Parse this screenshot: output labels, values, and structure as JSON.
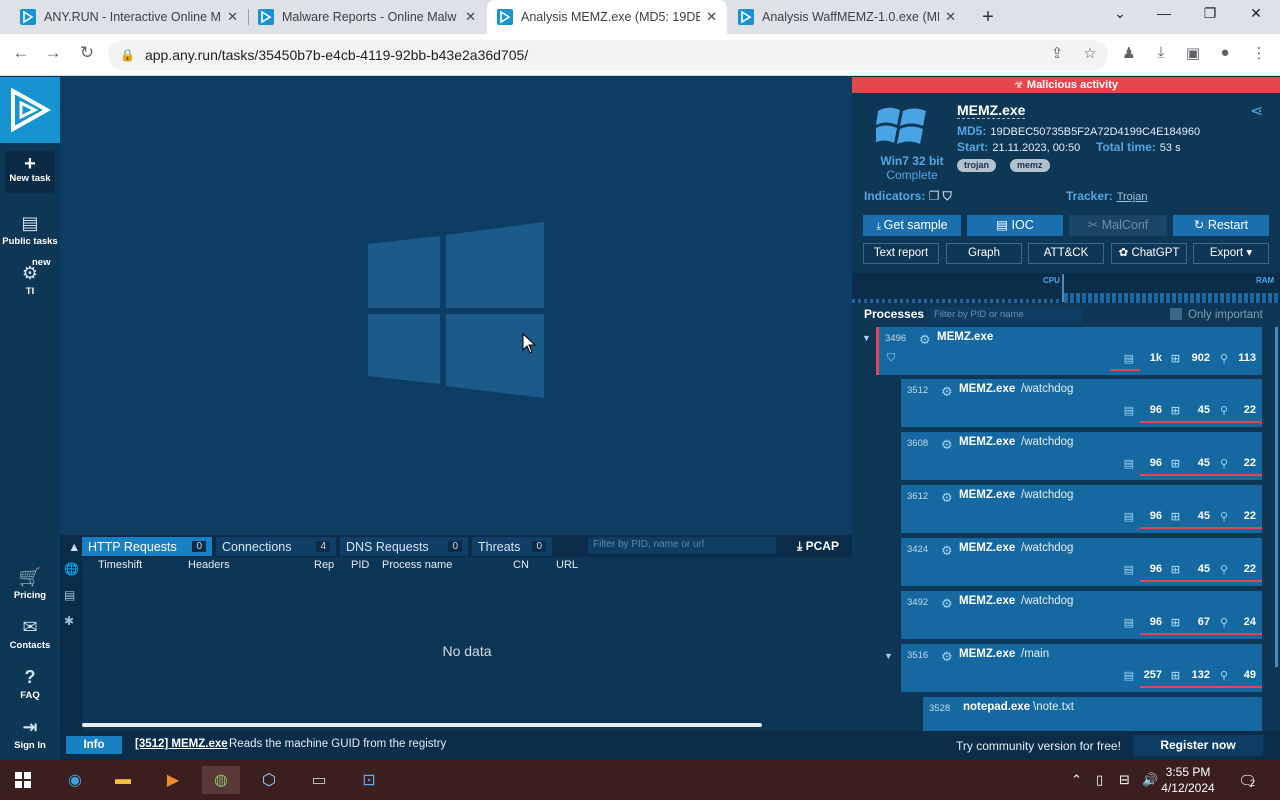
{
  "browser": {
    "tabs": [
      {
        "title": "ANY.RUN - Interactive Online M",
        "active": false
      },
      {
        "title": "Malware Reports - Online Malw",
        "active": false
      },
      {
        "title": "Analysis MEMZ.exe (MD5: 19DB",
        "active": true
      },
      {
        "title": "Analysis WaffMEMZ-1.0.exe (MD",
        "active": false
      }
    ],
    "url": "app.any.run/tasks/35450b7b-e4cb-4119-92bb-b43e2a36d705/"
  },
  "sidebar": {
    "new_task": "New task",
    "public_tasks": "Public tasks",
    "ti": "TI",
    "ti_badge": "new",
    "pricing": "Pricing",
    "contacts": "Contacts",
    "faq": "FAQ",
    "sign_in": "Sign In"
  },
  "network": {
    "tabs": [
      {
        "label": "HTTP Requests",
        "count": "0"
      },
      {
        "label": "Connections",
        "count": "4"
      },
      {
        "label": "DNS Requests",
        "count": "0"
      },
      {
        "label": "Threats",
        "count": "0"
      }
    ],
    "filter_placeholder": "Filter by PID, name or url",
    "pcap": "PCAP",
    "columns": [
      "Timeshift",
      "Headers",
      "Rep",
      "PID",
      "Process name",
      "CN",
      "URL"
    ],
    "empty": "No data"
  },
  "status": {
    "info": "Info",
    "process": "[3512] MEMZ.exe",
    "message": "Reads the machine GUID from the registry",
    "community": "Try community version for free!",
    "register": "Register now"
  },
  "task": {
    "banner": "Malicious activity",
    "filename": "MEMZ.exe",
    "os": "Win7 32 bit",
    "os_status": "Complete",
    "md5_label": "MD5:",
    "md5": "19DBEC50735B5F2A72D4199C4E184960",
    "start_label": "Start:",
    "start": "21.11.2023, 00:50",
    "total_label": "Total time:",
    "total": "53 s",
    "tags": [
      "trojan",
      "memz"
    ],
    "indicators_label": "Indicators:",
    "tracker_label": "Tracker:",
    "tracker_value": "Trojan",
    "buttons": {
      "get_sample": "Get sample",
      "ioc": "IOC",
      "malconf": "MalConf",
      "restart": "Restart",
      "text_report": "Text report",
      "graph": "Graph",
      "attck": "ATT&CK",
      "chatgpt": "ChatGPT",
      "export": "Export"
    },
    "cpu_label": "CPU",
    "ram_label": "RAM"
  },
  "processes": {
    "title": "Processes",
    "filter_placeholder": "Filter by PID or name",
    "only_important": "Only important",
    "items": [
      {
        "pid": "3496",
        "name": "MEMZ.exe",
        "arg": "",
        "files": "1k",
        "reg": "902",
        "mods": "113"
      },
      {
        "pid": "3512",
        "name": "MEMZ.exe",
        "arg": "/watchdog",
        "files": "96",
        "reg": "45",
        "mods": "22"
      },
      {
        "pid": "3608",
        "name": "MEMZ.exe",
        "arg": "/watchdog",
        "files": "96",
        "reg": "45",
        "mods": "22"
      },
      {
        "pid": "3612",
        "name": "MEMZ.exe",
        "arg": "/watchdog",
        "files": "96",
        "reg": "45",
        "mods": "22"
      },
      {
        "pid": "3424",
        "name": "MEMZ.exe",
        "arg": "/watchdog",
        "files": "96",
        "reg": "45",
        "mods": "22"
      },
      {
        "pid": "3492",
        "name": "MEMZ.exe",
        "arg": "/watchdog",
        "files": "96",
        "reg": "67",
        "mods": "24"
      },
      {
        "pid": "3516",
        "name": "MEMZ.exe",
        "arg": "/main",
        "files": "257",
        "reg": "132",
        "mods": "49"
      },
      {
        "pid": "3528",
        "name": "notepad.exe",
        "arg": "\\note.txt",
        "files": "",
        "reg": "",
        "mods": ""
      }
    ]
  },
  "taskbar": {
    "time": "3:55 PM",
    "date": "4/12/2024",
    "notifications": "2"
  }
}
